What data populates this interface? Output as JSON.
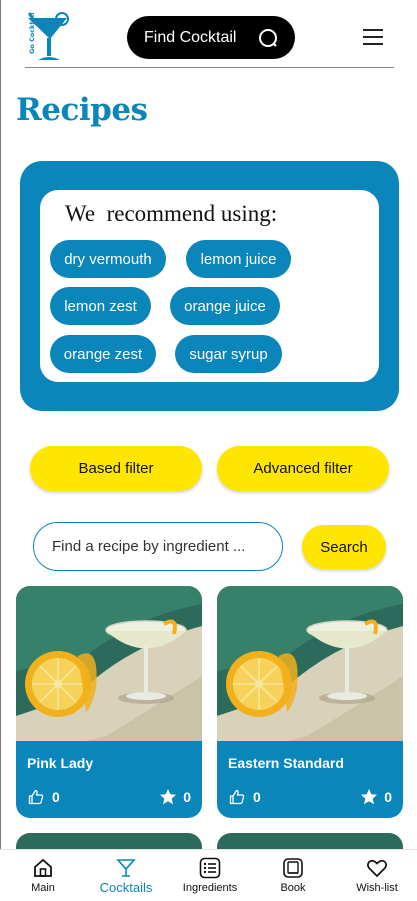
{
  "header": {
    "logo_text": "Go Cocktail",
    "find_button_label": "Find Cocktail",
    "find_icon": "search-icon",
    "menu_icon": "hamburger-icon"
  },
  "page_title": "Recipes",
  "recommend": {
    "title": "We  recommend using:",
    "chips": [
      "dry vermouth",
      "lemon juice",
      "lemon zest",
      "orange juice",
      "orange zest",
      "sugar syrup"
    ]
  },
  "filters": {
    "based_label": "Based filter",
    "advanced_label": "Advanced filter"
  },
  "search": {
    "placeholder": "Find a recipe by ingredient ...",
    "button_label": "Search"
  },
  "recipes": [
    {
      "name": "Pink Lady",
      "likes": "0",
      "favorites": "0"
    },
    {
      "name": "Eastern Standard",
      "likes": "0",
      "favorites": "0"
    }
  ],
  "nav": [
    {
      "label": "Main",
      "icon": "home-icon",
      "active": false
    },
    {
      "label": "Cocktails",
      "icon": "cocktail-glass-icon",
      "active": true
    },
    {
      "label": "Ingredients",
      "icon": "list-icon",
      "active": false
    },
    {
      "label": "Book",
      "icon": "book-icon",
      "active": false
    },
    {
      "label": "Wish-list",
      "icon": "heart-icon",
      "active": false
    }
  ],
  "colors": {
    "brand_blue": "#0b86ba",
    "accent_yellow": "#ffe600",
    "dark": "#000000"
  }
}
